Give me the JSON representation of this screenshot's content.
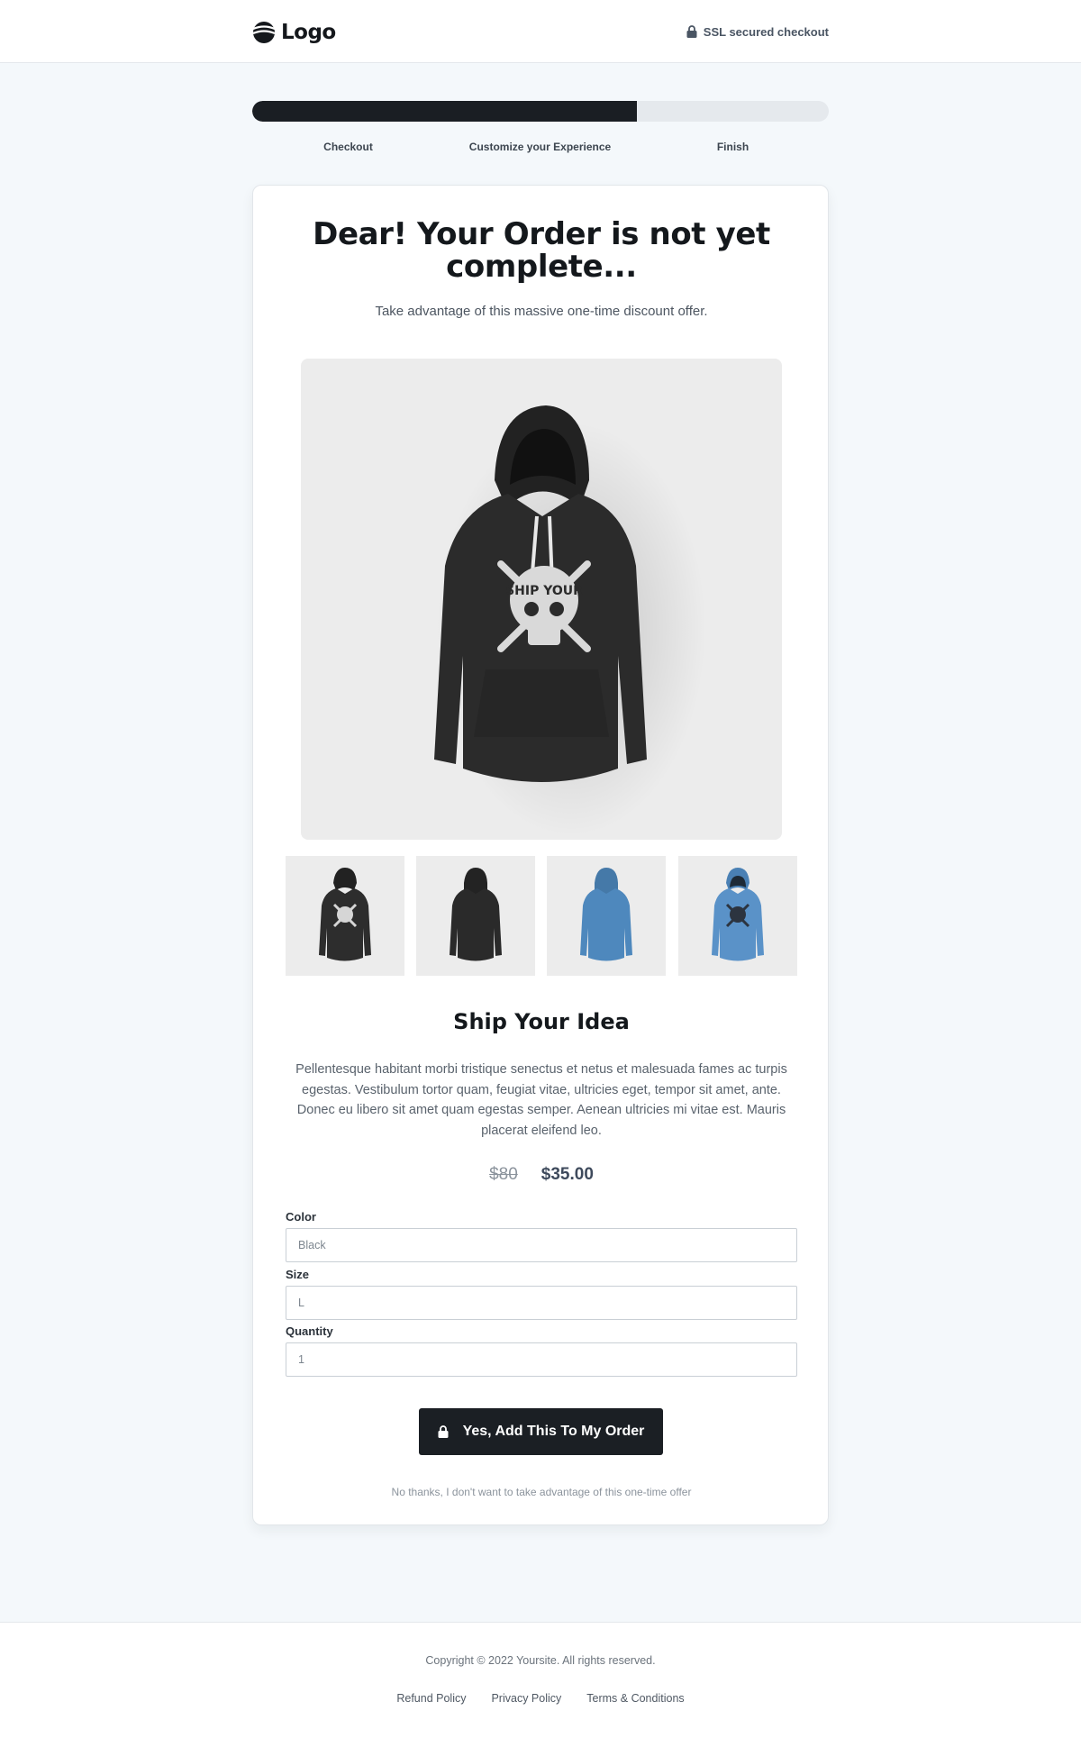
{
  "header": {
    "logo_text": "Logo",
    "ssl_text": "SSL secured checkout"
  },
  "progress": {
    "completed_fraction": 0.667,
    "steps": [
      {
        "label": "Checkout"
      },
      {
        "label": "Customize your Experience"
      },
      {
        "label": "Finish"
      }
    ]
  },
  "offer": {
    "title": "Dear! Your Order is not yet complete...",
    "subtitle": "Take advantage of this massive one-time discount offer."
  },
  "product": {
    "thumbnails": [
      {
        "color": "#2d2d2d",
        "print": true
      },
      {
        "color": "#2a2a2a",
        "print": false
      },
      {
        "color": "#4e88bd",
        "print": false
      },
      {
        "color": "#5a92c8",
        "print": true
      }
    ],
    "name": "Ship Your Idea",
    "description": "Pellentesque habitant morbi tristique senectus et netus et malesuada fames ac turpis egestas. Vestibulum tortor quam, feugiat vitae, ultricies eget, tempor sit amet, ante. Donec eu libero sit amet quam egestas semper. Aenean ultricies mi vitae est. Mauris placerat eleifend leo.",
    "price_old": "$80",
    "price_new": "$35.00"
  },
  "form": {
    "color_label": "Color",
    "color_value": "Black",
    "size_label": "Size",
    "size_value": "L",
    "quantity_label": "Quantity",
    "quantity_value": "1"
  },
  "cta": {
    "accept_label": "Yes, Add This To My Order",
    "decline_label": "No thanks, I don't want to take advantage of this one-time offer"
  },
  "footer": {
    "copyright": "Copyright © 2022 Yoursite. All rights reserved.",
    "links": [
      {
        "label": "Refund Policy"
      },
      {
        "label": "Privacy Policy"
      },
      {
        "label": "Terms & Conditions"
      }
    ]
  },
  "colors": {
    "primary": "#1b1f24",
    "page_background": "#f4f8fb",
    "progress_track": "#e5e9ed"
  }
}
